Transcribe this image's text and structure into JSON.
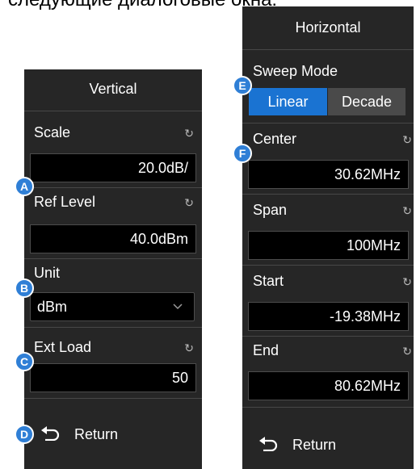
{
  "caption": "следующие диалоговые окна:",
  "vertical": {
    "title": "Vertical",
    "scale": {
      "label": "Scale",
      "value": "20.0dB/"
    },
    "ref_level": {
      "label": "Ref Level",
      "value": "40.0dBm"
    },
    "unit": {
      "label": "Unit",
      "value": "dBm"
    },
    "ext_load": {
      "label": "Ext Load",
      "value": "50"
    },
    "return_label": "Return"
  },
  "horizontal": {
    "title": "Horizontal",
    "sweep_mode": {
      "label": "Sweep Mode",
      "options": [
        "Linear",
        "Decade"
      ],
      "selected": "Linear"
    },
    "center": {
      "label": "Center",
      "value": "30.62MHz"
    },
    "span": {
      "label": "Span",
      "value": "100MHz"
    },
    "start": {
      "label": "Start",
      "value": "-19.38MHz"
    },
    "end": {
      "label": "End",
      "value": "80.62MHz"
    },
    "return_label": "Return"
  },
  "markers": [
    "A",
    "B",
    "C",
    "D",
    "E",
    "F"
  ],
  "icons": {
    "knob": "knob-refresh-icon",
    "return": "return-arrow-icon",
    "dropdown": "chevron-down-icon"
  },
  "colors": {
    "panel_bg": "#262626",
    "accent": "#1a73d2",
    "marker": "#2f7fd6"
  }
}
